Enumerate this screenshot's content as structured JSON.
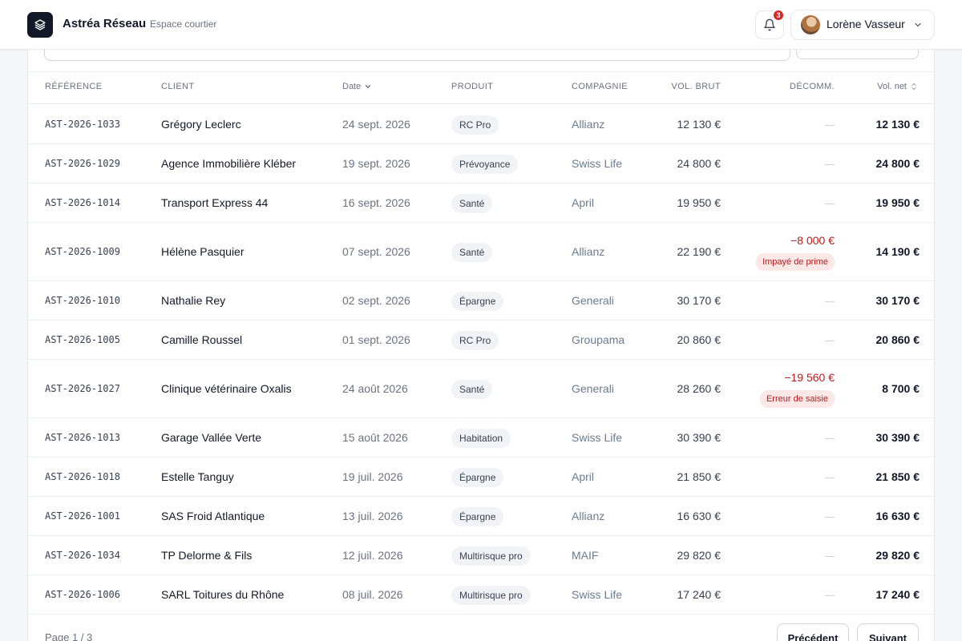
{
  "header": {
    "brand": "Astréa Réseau",
    "subtitle": "Espace courtier",
    "notifications_count": "3",
    "user_name": "Lorène Vasseur"
  },
  "table": {
    "columns": {
      "reference": "RÉFÉRENCE",
      "client": "CLIENT",
      "date": "Date",
      "produit": "PRODUIT",
      "compagnie": "COMPAGNIE",
      "vol_brut": "VOL. BRUT",
      "decomm": "DÉCOMM.",
      "vol_net": "Vol. net"
    },
    "rows": [
      {
        "ref": "AST-2026-1033",
        "client": "Grégory Leclerc",
        "date": "24 sept. 2026",
        "produit": "RC Pro",
        "compagnie": "Allianz",
        "brut": "12 130 €",
        "decomm": "",
        "reason": "",
        "net": "12 130 €"
      },
      {
        "ref": "AST-2026-1029",
        "client": "Agence Immobilière Kléber",
        "date": "19 sept. 2026",
        "produit": "Prévoyance",
        "compagnie": "Swiss Life",
        "brut": "24 800 €",
        "decomm": "",
        "reason": "",
        "net": "24 800 €"
      },
      {
        "ref": "AST-2026-1014",
        "client": "Transport Express 44",
        "date": "16 sept. 2026",
        "produit": "Santé",
        "compagnie": "April",
        "brut": "19 950 €",
        "decomm": "",
        "reason": "",
        "net": "19 950 €"
      },
      {
        "ref": "AST-2026-1009",
        "client": "Hélène Pasquier",
        "date": "07 sept. 2026",
        "produit": "Santé",
        "compagnie": "Allianz",
        "brut": "22 190 €",
        "decomm": "−8 000 €",
        "reason": "Impayé de prime",
        "net": "14 190 €"
      },
      {
        "ref": "AST-2026-1010",
        "client": "Nathalie Rey",
        "date": "02 sept. 2026",
        "produit": "Épargne",
        "compagnie": "Generali",
        "brut": "30 170 €",
        "decomm": "",
        "reason": "",
        "net": "30 170 €"
      },
      {
        "ref": "AST-2026-1005",
        "client": "Camille Roussel",
        "date": "01 sept. 2026",
        "produit": "RC Pro",
        "compagnie": "Groupama",
        "brut": "20 860 €",
        "decomm": "",
        "reason": "",
        "net": "20 860 €"
      },
      {
        "ref": "AST-2026-1027",
        "client": "Clinique vétérinaire Oxalis",
        "date": "24 août 2026",
        "produit": "Santé",
        "compagnie": "Generali",
        "brut": "28 260 €",
        "decomm": "−19 560 €",
        "reason": "Erreur de saisie",
        "net": "8 700 €"
      },
      {
        "ref": "AST-2026-1013",
        "client": "Garage Vallée Verte",
        "date": "15 août 2026",
        "produit": "Habitation",
        "compagnie": "Swiss Life",
        "brut": "30 390 €",
        "decomm": "",
        "reason": "",
        "net": "30 390 €"
      },
      {
        "ref": "AST-2026-1018",
        "client": "Estelle Tanguy",
        "date": "19 juil. 2026",
        "produit": "Épargne",
        "compagnie": "April",
        "brut": "21 850 €",
        "decomm": "",
        "reason": "",
        "net": "21 850 €"
      },
      {
        "ref": "AST-2026-1001",
        "client": "SAS Froid Atlantique",
        "date": "13 juil. 2026",
        "produit": "Épargne",
        "compagnie": "Allianz",
        "brut": "16 630 €",
        "decomm": "",
        "reason": "",
        "net": "16 630 €"
      },
      {
        "ref": "AST-2026-1034",
        "client": "TP Delorme & Fils",
        "date": "12 juil. 2026",
        "produit": "Multirisque pro",
        "compagnie": "MAIF",
        "brut": "29 820 €",
        "decomm": "",
        "reason": "",
        "net": "29 820 €"
      },
      {
        "ref": "AST-2026-1006",
        "client": "SARL Toitures du Rhône",
        "date": "08 juil. 2026",
        "produit": "Multirisque pro",
        "compagnie": "Swiss Life",
        "brut": "17 240 €",
        "decomm": "",
        "reason": "",
        "net": "17 240 €"
      }
    ]
  },
  "pagination": {
    "info": "Page 1 / 3",
    "prev_label": "Précédent",
    "next_label": "Suivant"
  },
  "icons": {
    "logo": "layers-icon",
    "notifications": "bell-icon",
    "user_menu": "chevron-down-icon",
    "date_sort": "sort-desc-icon",
    "net_sort": "sort-icon"
  },
  "colors": {
    "negative": "#b91c1c",
    "badge": "#dc2626"
  }
}
